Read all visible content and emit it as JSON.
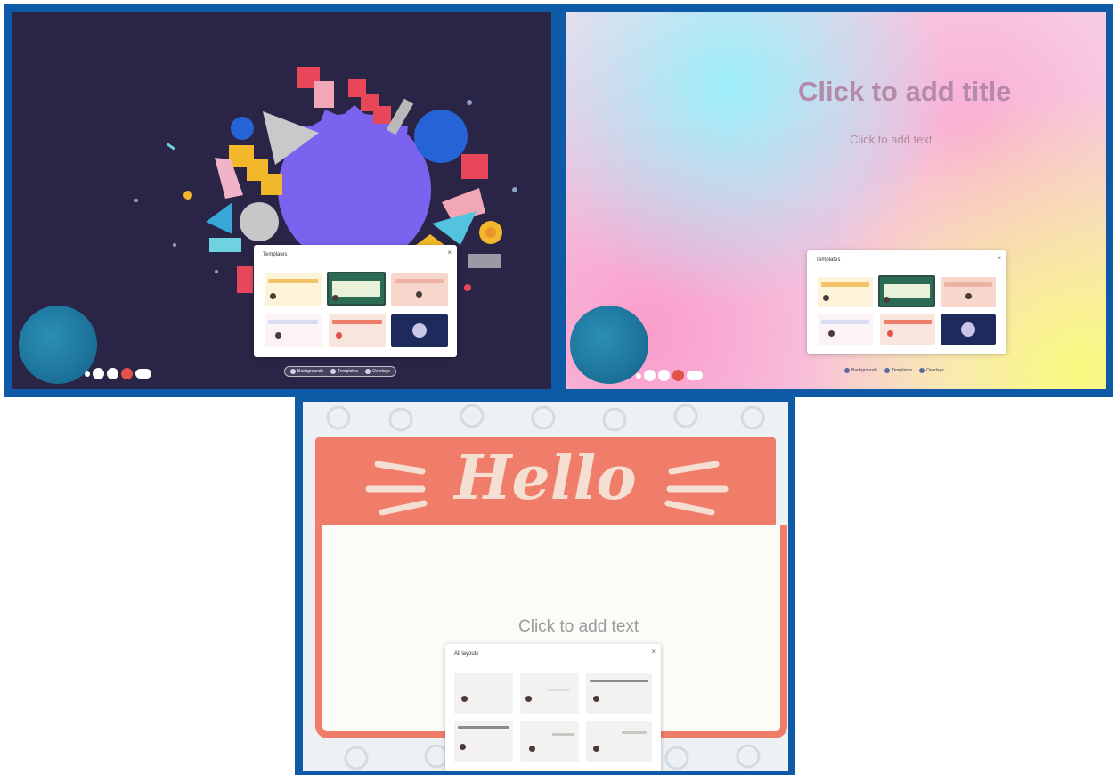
{
  "panel_left": {
    "controls": [
      "dot",
      "mic-button",
      "video-button",
      "record-button",
      "more-button"
    ],
    "popup": {
      "title": "Templates",
      "close": "×",
      "thumbnails": [
        "template-1",
        "template-2",
        "template-3",
        "template-4",
        "template-5",
        "template-6"
      ]
    },
    "bottom_bar": [
      "Backgrounds",
      "Templates",
      "Overlays"
    ]
  },
  "panel_right": {
    "title": "Click to add title",
    "subtitle": "Click to add text",
    "popup": {
      "title": "Templates",
      "close": "×"
    },
    "bottom_bar": [
      "Backgrounds",
      "Templates",
      "Overlays"
    ]
  },
  "panel_bottom": {
    "heading": "Hello",
    "body_text": "Click to add text",
    "popup": {
      "title": "All layouts",
      "close": "×"
    }
  },
  "colors": {
    "frame": "#0e5aa6",
    "dark_bg": "#2a2546",
    "accent_red": "#e0524a",
    "hello_coral": "#ef7d6a",
    "avatar": "#1f78a5"
  }
}
